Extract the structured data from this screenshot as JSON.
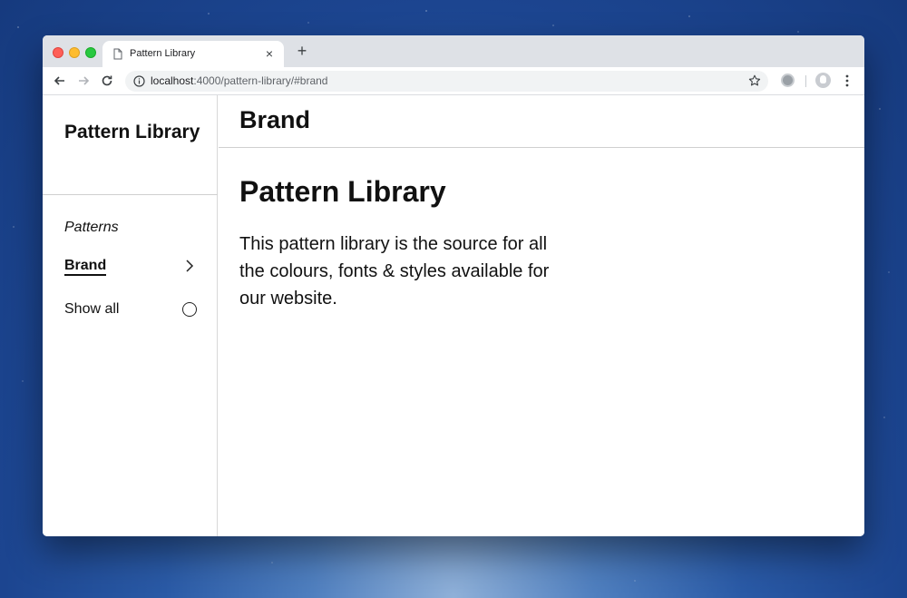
{
  "browser": {
    "tab_title": "Pattern Library",
    "tab_close_glyph": "×",
    "new_tab_glyph": "+",
    "url_host": "localhost",
    "url_rest": ":4000/pattern-library/#brand"
  },
  "sidebar": {
    "title": "Pattern Library",
    "section_label": "Patterns",
    "items": [
      {
        "label": "Brand",
        "icon": "chevron-right-icon",
        "active": true
      },
      {
        "label": "Show all",
        "icon": "circle-icon",
        "active": false
      }
    ]
  },
  "main": {
    "header_title": "Brand",
    "page_title": "Pattern Library",
    "intro": "This pattern library is the source for all the colours, fonts & styles available for our website."
  },
  "colors": {
    "text": "#111111",
    "tabstrip": "#dee1e6",
    "omnibox": "#f1f3f4",
    "divider": "#d0d0d0"
  }
}
